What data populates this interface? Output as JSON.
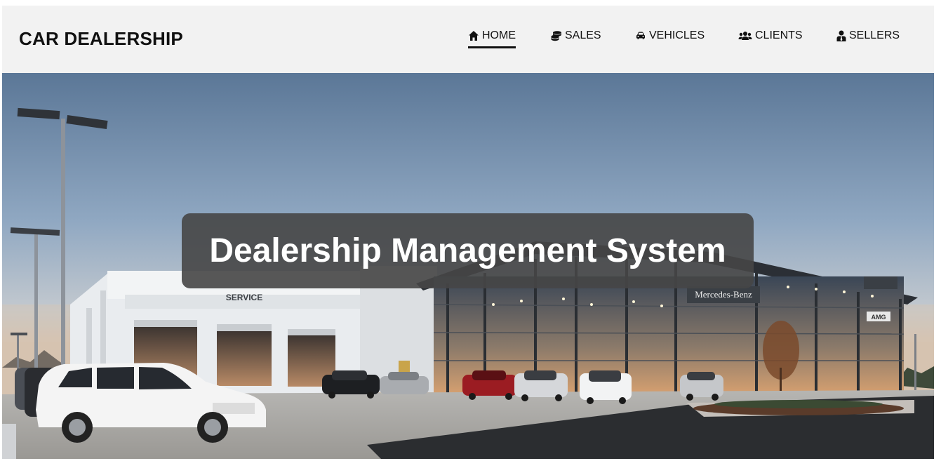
{
  "header": {
    "brand": "CAR DEALERSHIP",
    "nav": [
      {
        "label": "HOME",
        "icon": "home-icon",
        "active": true
      },
      {
        "label": "SALES",
        "icon": "coins-icon",
        "active": false
      },
      {
        "label": "VEHICLES",
        "icon": "car-icon",
        "active": false
      },
      {
        "label": "CLIENTS",
        "icon": "users-icon",
        "active": false
      },
      {
        "label": "SELLERS",
        "icon": "user-tie-icon",
        "active": false
      }
    ]
  },
  "hero": {
    "title": "Dealership Management System",
    "image_signs": {
      "service": "SERVICE",
      "brand_sign": "Mercedes-Benz",
      "amg": "AMG"
    }
  },
  "colors": {
    "navbar_bg": "#f2f2f2",
    "text": "#111111",
    "banner_bg": "#464646",
    "sky_top": "#5b7797",
    "sky_bottom": "#c9ccce"
  }
}
